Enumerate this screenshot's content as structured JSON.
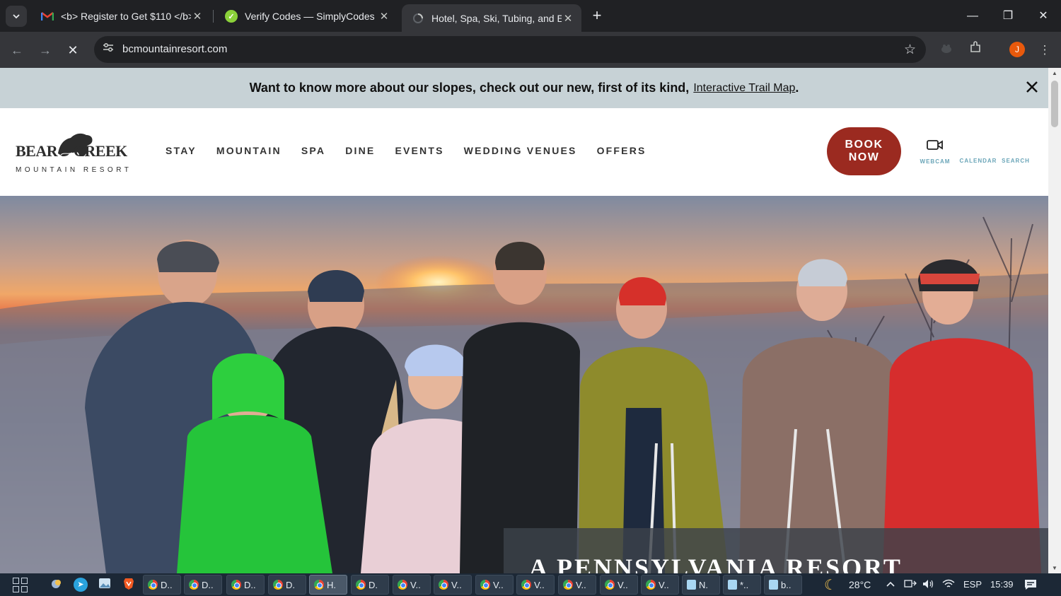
{
  "browser": {
    "tabs": [
      {
        "title": "<b> Register to Get $110 </b>",
        "favicon": "gmail-icon",
        "active": false
      },
      {
        "title": "Verify Codes — SimplyCodes",
        "favicon": "simplycodes-icon",
        "active": false
      },
      {
        "title": "Hotel, Spa, Ski, Tubing, and Eve",
        "favicon": "loading-icon",
        "active": true
      }
    ],
    "url": "bcmountainresort.com",
    "profile_initial": "J"
  },
  "announcement": {
    "text": "Want to know more about our slopes, check out our new, first of its kind,",
    "link_text": "Interactive Trail Map",
    "suffix": "."
  },
  "site": {
    "logo": {
      "word1": "BEAR",
      "word2": "CREEK",
      "sub": "MOUNTAIN RESORT"
    },
    "nav": [
      "STAY",
      "MOUNTAIN",
      "SPA",
      "DINE",
      "EVENTS",
      "WEDDING VENUES",
      "OFFERS"
    ],
    "book": {
      "line1": "BOOK",
      "line2": "NOW"
    },
    "utilities": {
      "webcam": "WEBCAM",
      "calendar": "CALENDAR",
      "search": "SEARCH"
    },
    "brand_color": "#9b2a20"
  },
  "hero": {
    "heading": "A PENNSYLVANIA RESORT"
  },
  "taskbar": {
    "apps": [
      {
        "label": "D..",
        "icon": "chrome-icon"
      },
      {
        "label": "D..",
        "icon": "chrome-icon"
      },
      {
        "label": "D..",
        "icon": "chrome-icon"
      },
      {
        "label": "D.",
        "icon": "chrome-icon"
      },
      {
        "label": "H.",
        "icon": "chrome-icon",
        "active": true
      },
      {
        "label": "D.",
        "icon": "chrome-icon"
      },
      {
        "label": "V..",
        "icon": "chrome-icon"
      },
      {
        "label": "V..",
        "icon": "chrome-icon"
      },
      {
        "label": "V..",
        "icon": "chrome-icon"
      },
      {
        "label": "V..",
        "icon": "chrome-icon"
      },
      {
        "label": "V..",
        "icon": "chrome-icon"
      },
      {
        "label": "V..",
        "icon": "chrome-icon"
      },
      {
        "label": "V..",
        "icon": "chrome-icon"
      },
      {
        "label": "N.",
        "icon": "notepad-icon"
      },
      {
        "label": "*..",
        "icon": "notepad-icon"
      },
      {
        "label": "b..",
        "icon": "notepad-icon"
      }
    ],
    "weather": "28°C",
    "language": "ESP",
    "time": "15:39"
  }
}
